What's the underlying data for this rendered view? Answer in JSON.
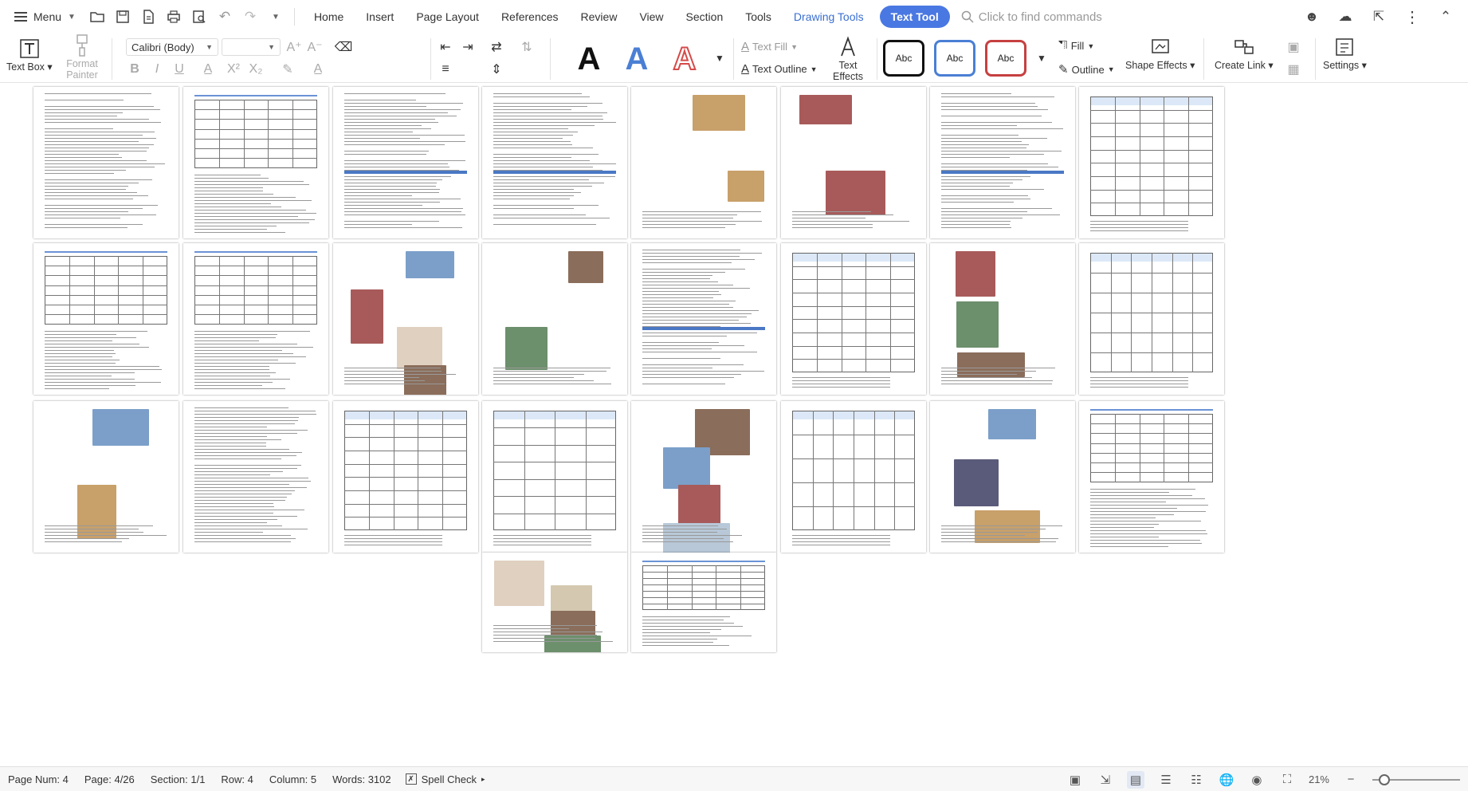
{
  "menubar": {
    "menu_label": "Menu",
    "tabs": [
      "Home",
      "Insert",
      "Page Layout",
      "References",
      "Review",
      "View",
      "Section",
      "Tools"
    ],
    "drawing_tools_label": "Drawing Tools",
    "text_tool_label": "Text Tool",
    "find_placeholder": "Click to find commands"
  },
  "ribbon": {
    "text_box_label": "Text Box",
    "format_painter_label": "Format Painter",
    "font_family": "Calibri (Body)",
    "text_fill_label": "Text Fill",
    "text_outline_label": "Text Outline",
    "text_effects_label": "Text Effects",
    "wordart_glyph": "A",
    "wordart_colors": [
      "#111111",
      "#4a7fd4",
      "#d64a4a"
    ],
    "shape_style_label": "Abc",
    "shape_style_borders": [
      "#111111",
      "#4a7fd4",
      "#c64040"
    ],
    "fill_label": "Fill",
    "outline_label": "Outline",
    "shape_effects_label": "Shape Effects",
    "create_link_label": "Create Link",
    "settings_label": "Settings"
  },
  "statusbar": {
    "page_num": "Page Num: 4",
    "page": "Page: 4/26",
    "section": "Section: 1/1",
    "row": "Row: 4",
    "column": "Column: 5",
    "words": "Words: 3102",
    "spell_check": "Spell Check",
    "zoom": "21%"
  },
  "accent_color": "#4a78e2"
}
